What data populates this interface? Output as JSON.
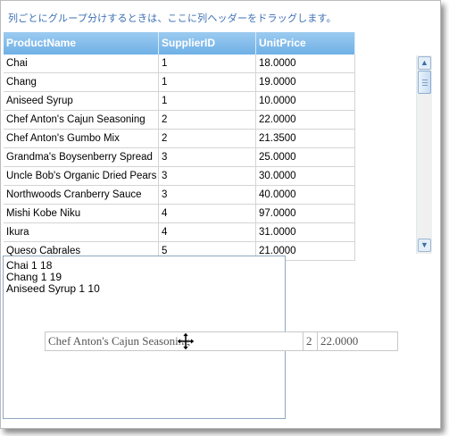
{
  "group_hint": "列ごとにグループ分けするときは、ここに列ヘッダーをドラッグします。",
  "columns": [
    "ProductName",
    "SupplierID",
    "UnitPrice"
  ],
  "rows": [
    [
      "Chai",
      "1",
      "18.0000"
    ],
    [
      "Chang",
      "1",
      "19.0000"
    ],
    [
      "Aniseed Syrup",
      "1",
      "10.0000"
    ],
    [
      "Chef Anton's Cajun Seasoning",
      "2",
      "22.0000"
    ],
    [
      "Chef Anton's Gumbo Mix",
      "2",
      "21.3500"
    ],
    [
      "Grandma's Boysenberry Spread",
      "3",
      "25.0000"
    ],
    [
      "Uncle Bob's Organic Dried Pears",
      "3",
      "30.0000"
    ],
    [
      "Northwoods Cranberry Sauce",
      "3",
      "40.0000"
    ],
    [
      "Mishi Kobe Niku",
      "4",
      "97.0000"
    ],
    [
      "Ikura",
      "4",
      "31.0000"
    ],
    [
      "Queso Cabrales",
      "5",
      "21.0000"
    ]
  ],
  "textbox_lines": [
    "Chai 1 18",
    "Chang 1 19",
    "Aniseed Syrup 1 10"
  ],
  "drag_row": [
    "Chef Anton's Cajun Seasoning",
    "2",
    "22.0000"
  ]
}
